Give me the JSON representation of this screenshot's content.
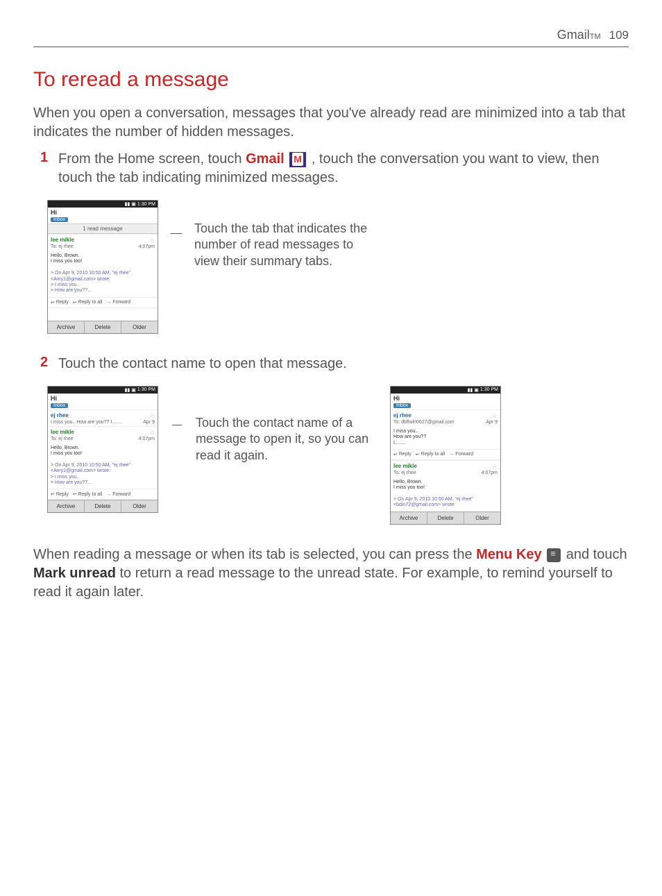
{
  "header": {
    "title": "Gmail",
    "tm": "TM",
    "page": "109"
  },
  "section_title": "To reread a message",
  "intro": "When you open a conversation, messages that you've already read are minimized into a tab that indicates the number of hidden messages.",
  "steps": {
    "s1": {
      "num": "1",
      "pre": "From the Home screen, touch ",
      "bold1": "Gmail",
      "mid": ", touch the conversation you want to view, then touch the tab indicating minimized messages."
    },
    "s2": {
      "num": "2",
      "text": "Touch the contact name to open that message."
    }
  },
  "captions": {
    "c1": "Touch the tab that indicates the number of read messages to view their summary tabs.",
    "c2": "Touch the contact name of a message to open it, so you can read it again."
  },
  "closing": {
    "pre": "When reading a message or when its tab is selected, you can press the ",
    "bold1": "Menu Key",
    "mid": " and touch ",
    "bold2": "Mark unread",
    "post": " to return a read message to the unread state. For example, to remind yourself to read it again later."
  },
  "phone": {
    "time": "1:30 PM",
    "subject": "Hi",
    "inbox": "Inbox",
    "read_tab": "1 read message",
    "from1": "lee mikle",
    "from2": "ej rhee",
    "to_ej": "To: ej rhee",
    "to_dbf": "To: dbflwlrl0627@gmail.com",
    "time_msg": "4:07pm",
    "date_short": "Apr 9",
    "snippet1": "I miss you.. How are you?? I........",
    "body_hello": "Hello, Brown.",
    "body_miss": "I miss you too!",
    "body_miss_q": "I miss you..",
    "body_how": "How are you??",
    "body_i": "I........",
    "quoted1": "> On Apr 9, 2010 10:50 AM, \"ej rhee\"",
    "quoted2": "<Amy1@gmail.com> wrote:",
    "quoted2b": "<bdin72@gmail.com> wrote:",
    "quoted3": "> I miss you..",
    "quoted4": "> How are you??...",
    "reply": "Reply",
    "reply_all": "Reply to all",
    "forward": "Forward",
    "archive": "Archive",
    "delete": "Delete",
    "older": "Older"
  }
}
